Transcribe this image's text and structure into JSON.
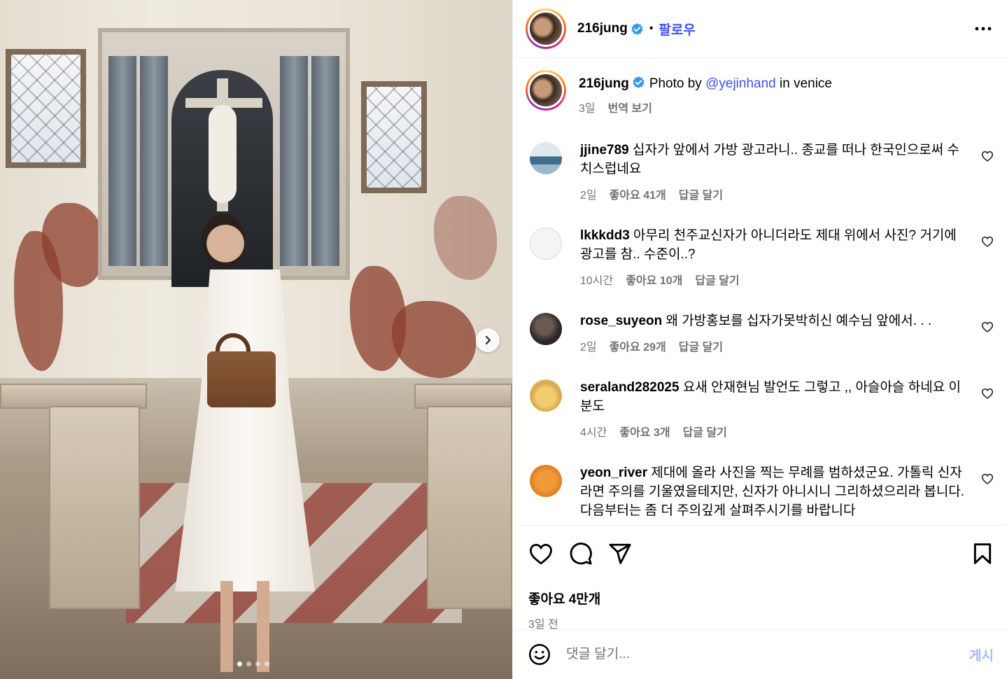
{
  "header": {
    "username": "216jung",
    "separator": "•",
    "follow_label": "팔로우"
  },
  "caption": {
    "username": "216jung",
    "text_before": "Photo by ",
    "mention": "@yejinhand",
    "text_after": " in venice",
    "time": "3일",
    "translate_label": "번역 보기"
  },
  "comments": [
    {
      "username": "jjine789",
      "text": "십자가 앞에서 가방 광고라니.. 종교를 떠나 한국인으로써 수치스럽네요",
      "time": "2일",
      "likes": "좋아요 41개",
      "reply": "답글 달기",
      "avatar_color": "#7aa3c2"
    },
    {
      "username": "lkkkdd3",
      "text": "아무리 천주교신자가 아니더라도 제대 위에서 사진? 거기에 광고를 참.. 수준이..?",
      "time": "10시간",
      "likes": "좋아요 10개",
      "reply": "답글 달기",
      "avatar_color": "#f4f4f4"
    },
    {
      "username": "rose_suyeon",
      "text": "왜 가방홍보를 십자가못박히신 예수님 앞에서. . .",
      "time": "2일",
      "likes": "좋아요 29개",
      "reply": "답글 달기",
      "avatar_color": "#3a3330"
    },
    {
      "username": "seraland282025",
      "text": "요새 안재현님 발언도 그렇고 ,, 아슬아슬 하네요 이분도",
      "time": "4시간",
      "likes": "좋아요 3개",
      "reply": "답글 달기",
      "avatar_color": "#e0b25a"
    },
    {
      "username": "yeon_river",
      "text": "제대에 올라 사진을 찍는 무례를 범하셨군요. 가톨릭 신자라면 주의를 기울였을테지만, 신자가 아니시니 그리하셨으리라 봅니다. 다음부터는 좀 더 주의깊게 살펴주시기를 바랍니다",
      "time": "",
      "likes": "",
      "reply": "",
      "avatar_color": "#e8892b"
    }
  ],
  "post": {
    "likes_label": "좋아요 4만개",
    "time_label": "3일 전"
  },
  "add_comment": {
    "placeholder": "댓글 달기...",
    "post_label": "게시"
  },
  "carousel": {
    "count": 4,
    "active_index": 0
  },
  "colors": {
    "link": "#4150f7",
    "muted": "#737373",
    "post_disabled": "#a8b8f8",
    "verified": "#3897f0"
  },
  "icons": [
    "more-icon",
    "verified-icon",
    "heart-icon",
    "comment-icon",
    "share-icon",
    "bookmark-icon",
    "emoji-icon",
    "chevron-right-icon"
  ]
}
